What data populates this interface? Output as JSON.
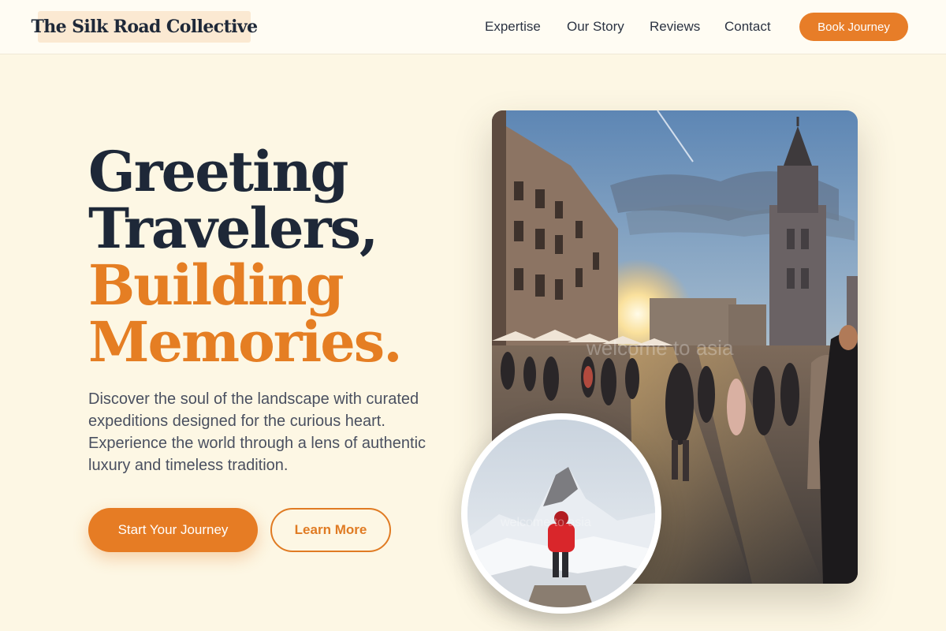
{
  "header": {
    "brand": "The Silk Road Collective",
    "nav": [
      "Expertise",
      "Our Story",
      "Reviews",
      "Contact"
    ],
    "book_label": "Book Journey"
  },
  "hero": {
    "headline_line1": "Greeting",
    "headline_line2": "Travelers,",
    "headline_line3": "Building",
    "headline_line4": "Memories.",
    "description": "Discover the soul of the landscape with curated expeditions designed for the curious heart. Experience the world through a lens of authentic luxury and timeless tradition.",
    "primary_cta": "Start Your Journey",
    "secondary_cta": "Learn More"
  },
  "images": {
    "main_photo": "old-town-square-sunset",
    "circle_photo": "mountain-hiker-red-jacket",
    "watermark": "welcome to asia"
  },
  "colors": {
    "accent": "#e67c24",
    "dark_text": "#1e2838",
    "background": "#fdf7e4",
    "brand_highlight": "#fbe9d2"
  }
}
